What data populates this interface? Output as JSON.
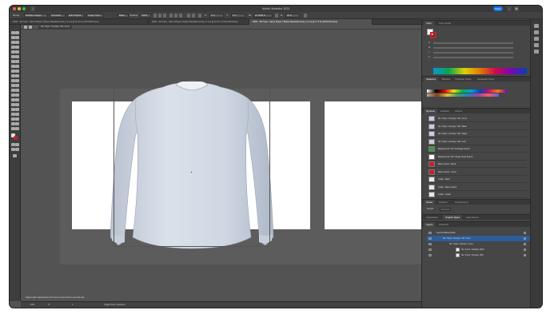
{
  "app": {
    "window_title": "Adobe Illustrator 2023",
    "share_label": "Share"
  },
  "control_bar": {
    "mode_label": "Group",
    "isolate_label": "Multiple Images",
    "embed_label": "Unembed",
    "edit_original_label": "Edit Original",
    "image_trace_label": "Image Trace",
    "mask_label": "Mask",
    "opacity_label": "Opacity:",
    "opacity_value": "100%",
    "x_label": "X:",
    "y_label": "Y:",
    "x_value": "0 in",
    "y_value": "0 in",
    "w_label": "W:",
    "h_label": "H:",
    "w_value": "27.5048 in",
    "h_value": "30 in"
  },
  "document_tabs": [
    {
      "label": "3D02 - 3D Trace - Men's Player 2 Button Baseball Jersey v1.1.ai @ 16.33 % (CMYK/Preview)",
      "active": false
    },
    {
      "label": "3D02 - 3D Trace - Men's Player 2 Button Baseball Jersey v1.2.ai @ 16.67 % (CMYK/Preview)",
      "active": false
    },
    {
      "label": "3D02 - 3D Trace - Men's Player 2 Button Baseball Jersey v1.3.ai @ 17.5 % (CMYK/Preview)",
      "active": true
    }
  ],
  "breadcrumb": "3D / Style / Overlay / 3D / Front",
  "status_bar": {
    "zoom": "16%",
    "rotation": "0°",
    "artboard": "1",
    "tool": "Toggle Direct Selection"
  },
  "tooltip": "Option-click \"Eyedropper tool\" icon to return how to use this tool.",
  "color_panel": {
    "tabs": [
      "Color",
      "Color Guide"
    ],
    "slider_labels": [
      "C",
      "M",
      "Y",
      "K"
    ]
  },
  "swatches_panel": {
    "tabs": [
      "Swatches",
      "Brushes",
      "Character Styles",
      "Paragraph Styles"
    ]
  },
  "symbols_panel": {
    "tabs": [
      "Symbols",
      "Libraries",
      "Actions"
    ],
    "items": [
      {
        "name": "3D / Style / Overlay / 3D / Front",
        "thumb": "#c9cde0"
      },
      {
        "name": "3D / Style / Overlay / 3D / Back",
        "thumb": "#c9cde0"
      },
      {
        "name": "3D / Style / Overlay / 3D / Right",
        "thumb": "#c9cde0"
      },
      {
        "name": "3D / Style / Overlay / 3D / Left",
        "thumb": "#c9cde0"
      },
      {
        "name": "Background / 3D / Package Export",
        "thumb": "#3e9a3e"
      },
      {
        "name": "Background / 3D / Single Style Export",
        "thumb": "#ffffff"
      },
      {
        "name": "Base Colors - Back",
        "thumb": "#c8202a"
      },
      {
        "name": "Base Colors - Front",
        "thumb": "#c8202a"
      },
      {
        "name": "Collar - Back",
        "thumb": "#e8e8e8"
      },
      {
        "name": "Collar - Base Colors",
        "thumb": "#e8e8e8"
      },
      {
        "name": "Collar - Inside",
        "thumb": "#e8e8e8"
      }
    ]
  },
  "stroke_panel": {
    "tabs": [
      "Stroke",
      "Gradient",
      "Transparency"
    ],
    "weight_label": "Weight:"
  },
  "appearance_panel": {
    "tabs": [
      "Appearance",
      "Graphic Styles",
      "Asset Export"
    ]
  },
  "layers_panel": {
    "tabs": [
      "Layers",
      "Artboards"
    ],
    "rows": [
      {
        "label": "Symbol Editing Mode",
        "indent": 0,
        "swatch": false
      },
      {
        "label": "3D / Style / Overlay / 3D / Front",
        "indent": 1,
        "swatch": false
      },
      {
        "label": "3D / Style / Overlay / Front",
        "indent": 2,
        "swatch": false
      },
      {
        "label": "3D / Front / Multiply 100%",
        "indent": 3,
        "swatch": true
      },
      {
        "label": "3D / Front / Overlay 70%",
        "indent": 3,
        "swatch": true
      }
    ]
  },
  "colors": {
    "ui_dark": "#535353",
    "panel": "#464646",
    "accent_blue": "#1473e6",
    "shirt": "#cfd7e3"
  }
}
